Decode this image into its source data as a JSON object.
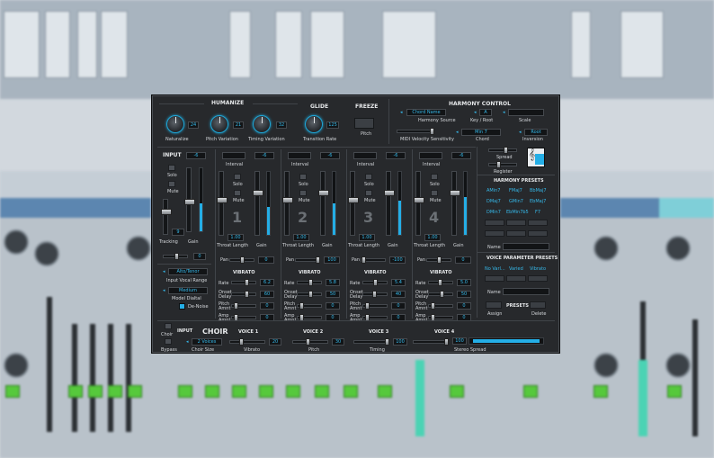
{
  "humanize": {
    "title": "HUMANIZE",
    "naturalize_value": "24",
    "naturalize_label": "Naturalize",
    "pitch_variation_value": "21",
    "pitch_variation_label": "Pitch Variation",
    "timing_variation_value": "32",
    "timing_variation_label": "Timing Variation"
  },
  "glide": {
    "title": "GLIDE",
    "value": "125",
    "label": "Transition Rate"
  },
  "freeze": {
    "title": "FREEZE",
    "label": "Pitch"
  },
  "harmony": {
    "title": "HARMONY CONTROL",
    "source_value": "Chord Name",
    "source_label": "Harmony Source",
    "key_value": "A",
    "key_label": "Key / Root",
    "scale_label": "Scale",
    "velocity_label": "MIDI Velocity Sensitivity",
    "chord_value": "Min 7",
    "chord_label": "Chord",
    "inversion_value": "Root",
    "inversion_label": "Inversion",
    "spread_label": "Spread",
    "register_label": "Register",
    "arrow_left": "◂",
    "arrow_right": "▸",
    "clef": "𝄞"
  },
  "input": {
    "title": "INPUT",
    "gain_value": "-6",
    "solo_label": "Solo",
    "mute_label": "Mute",
    "tracking_value": "9",
    "tracking_label": "Tracking",
    "gain_label": "Gain",
    "pan_value": "0",
    "range_value": "Alto/Tenor",
    "range_label": "Input Vocal Range",
    "model_value": "Medium",
    "model_label": "Model Dialtal",
    "denoise_label": "De-Noise"
  },
  "voices": [
    {
      "num": "1",
      "interval_label": "Interval",
      "gain": "-6",
      "solo": "Solo",
      "mute": "Mute",
      "throat": "1.00",
      "throat_label": "Throat Length",
      "gain_label": "Gain",
      "pan_label": "Pan",
      "pan": "0",
      "vibrato": "VIBRATO",
      "rate": "6.2",
      "onset_delay": "60",
      "pitch_amnt": "0",
      "amp_amnt": "0"
    },
    {
      "num": "2",
      "interval_label": "Interval",
      "gain": "-6",
      "solo": "Solo",
      "mute": "Mute",
      "throat": "1.00",
      "throat_label": "Throat Length",
      "gain_label": "Gain",
      "pan_label": "Pan",
      "pan": "100",
      "vibrato": "VIBRATO",
      "rate": "5.8",
      "onset_delay": "50",
      "pitch_amnt": "0",
      "amp_amnt": "0"
    },
    {
      "num": "3",
      "interval_label": "Interval",
      "gain": "-6",
      "solo": "Solo",
      "mute": "Mute",
      "throat": "1.00",
      "throat_label": "Throat Length",
      "gain_label": "Gain",
      "pan_label": "Pan",
      "pan": "-100",
      "vibrato": "VIBRATO",
      "rate": "5.4",
      "onset_delay": "40",
      "pitch_amnt": "0",
      "amp_amnt": "0"
    },
    {
      "num": "4",
      "interval_label": "Interval",
      "gain": "-6",
      "solo": "Solo",
      "mute": "Mute",
      "throat": "1.00",
      "throat_label": "Throat Length",
      "gain_label": "Gain",
      "pan_label": "Pan",
      "pan": "0",
      "vibrato": "VIBRATO",
      "rate": "5.0",
      "onset_delay": "50",
      "pitch_amnt": "0",
      "amp_amnt": "0"
    }
  ],
  "vibrato_labels": {
    "rate": "Rate",
    "onset": "Onset",
    "delay": "Delay",
    "pitch": "Pitch",
    "amp": "Amp",
    "amnt": "Amnt"
  },
  "harmony_presets": {
    "title": "HARMONY PRESETS",
    "items": [
      "AMin7",
      "FMaj7",
      "BbMaj7",
      "DMaj7",
      "GMin7",
      "EbMaj7",
      "DMin7",
      "EbMin7b5",
      "F7"
    ],
    "name_label": "Name"
  },
  "voice_presets": {
    "title": "VOICE PARAMETER PRESETS",
    "items": [
      "No Varl...",
      "Varied",
      "Vibrato"
    ],
    "name_label": "Name",
    "presets_label": "PRESETS",
    "assign_label": "Assign",
    "delete_label": "Delete"
  },
  "choir": {
    "title": "CHOIR",
    "choir_toggle": "Choir",
    "bypass_label": "Bypass",
    "input_label": "INPUT",
    "size_value": "2 Voices",
    "size_label": "Choir Size",
    "voice1": "VOICE 1",
    "voice2": "VOICE 2",
    "voice3": "VOICE 3",
    "voice4": "VOICE 4",
    "vibrato_value": "20",
    "vibrato_label": "Vibrato",
    "pitch_value": "30",
    "pitch_label": "Pitch",
    "timing_value": "100",
    "timing_label": "Timing",
    "spread_value": "100",
    "spread_label": "Stereo Spread"
  },
  "colors": {
    "accent": "#24aee6",
    "panel": "#27292c",
    "daw_green": "#56c93c"
  }
}
